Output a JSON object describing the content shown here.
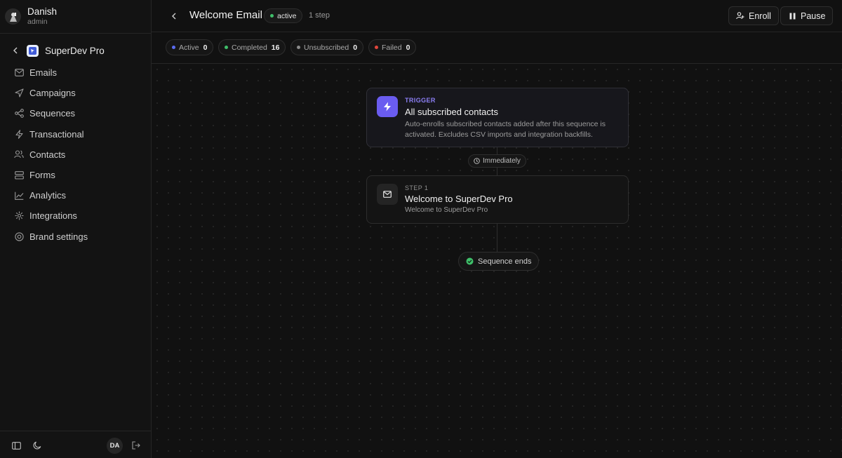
{
  "user": {
    "name": "Danish",
    "role": "admin",
    "initials": "DA"
  },
  "project": {
    "name": "SuperDev Pro"
  },
  "sidebar": {
    "items": [
      {
        "label": "Emails",
        "icon": "mail-icon"
      },
      {
        "label": "Campaigns",
        "icon": "send-icon"
      },
      {
        "label": "Sequences",
        "icon": "workflow-icon"
      },
      {
        "label": "Transactional",
        "icon": "zap-icon"
      },
      {
        "label": "Contacts",
        "icon": "users-icon"
      },
      {
        "label": "Forms",
        "icon": "form-icon"
      },
      {
        "label": "Analytics",
        "icon": "chart-icon"
      },
      {
        "label": "Integrations",
        "icon": "plug-icon"
      },
      {
        "label": "Brand settings",
        "icon": "gear-icon"
      }
    ]
  },
  "header": {
    "title": "Welcome Email",
    "status": "active",
    "step_count": "1 step",
    "enroll_label": "Enroll",
    "pause_label": "Pause"
  },
  "stats": [
    {
      "label": "Active",
      "value": "0",
      "color": "#5b6cf0"
    },
    {
      "label": "Completed",
      "value": "16",
      "color": "#3fbf6a"
    },
    {
      "label": "Unsubscribed",
      "value": "0",
      "color": "#8a8a8a"
    },
    {
      "label": "Failed",
      "value": "0",
      "color": "#e0463c"
    }
  ],
  "trigger": {
    "label": "TRIGGER",
    "title": "All subscribed contacts",
    "description": "Auto-enrolls subscribed contacts added after this sequence is activated. Excludes CSV imports and integration backfills."
  },
  "delay": {
    "label": "Immediately"
  },
  "step": {
    "label": "STEP 1",
    "title": "Welcome to SuperDev Pro",
    "subject": "Welcome to SuperDev Pro"
  },
  "end": {
    "label": "Sequence ends"
  },
  "colors": {
    "accent": "#6a5cf0",
    "status_active": "#3fbf6a"
  }
}
